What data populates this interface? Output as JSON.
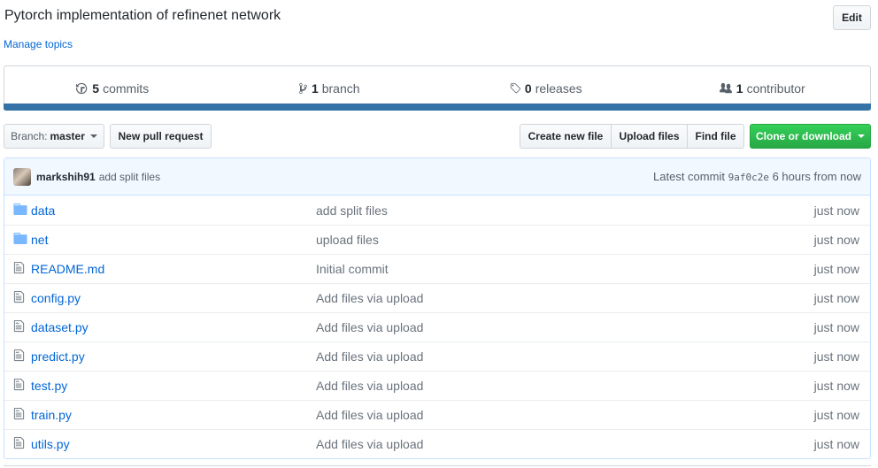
{
  "repo": {
    "description": "Pytorch implementation of refinenet network",
    "manage_topics": "Manage topics",
    "edit_label": "Edit"
  },
  "summary": {
    "commits": {
      "count": "5",
      "label": "commits",
      "icon": "history-icon"
    },
    "branches": {
      "count": "1",
      "label": "branch",
      "icon": "git-branch-icon"
    },
    "releases": {
      "count": "0",
      "label": "releases",
      "icon": "tag-icon"
    },
    "contributors": {
      "count": "1",
      "label": "contributor",
      "icon": "organization-icon"
    },
    "language_color": "#3572a5"
  },
  "toolbar": {
    "branch_prefix": "Branch:",
    "branch_name": "master",
    "new_pr": "New pull request",
    "create_file": "Create new file",
    "upload_files": "Upload files",
    "find_file": "Find file",
    "clone": "Clone or download",
    "clone_color": "#28a745"
  },
  "commit": {
    "author": "markshih91",
    "message": "add split files",
    "latest_label": "Latest commit",
    "sha": "9af0c2e",
    "time": "6 hours from now"
  },
  "files": [
    {
      "name": "data",
      "type": "dir",
      "message": "add split files",
      "age": "just now"
    },
    {
      "name": "net",
      "type": "dir",
      "message": "upload files",
      "age": "just now"
    },
    {
      "name": "README.md",
      "type": "file",
      "message": "Initial commit",
      "age": "just now"
    },
    {
      "name": "config.py",
      "type": "file",
      "message": "Add files via upload",
      "age": "just now"
    },
    {
      "name": "dataset.py",
      "type": "file",
      "message": "Add files via upload",
      "age": "just now"
    },
    {
      "name": "predict.py",
      "type": "file",
      "message": "Add files via upload",
      "age": "just now"
    },
    {
      "name": "test.py",
      "type": "file",
      "message": "Add files via upload",
      "age": "just now"
    },
    {
      "name": "train.py",
      "type": "file",
      "message": "Add files via upload",
      "age": "just now"
    },
    {
      "name": "utils.py",
      "type": "file",
      "message": "Add files via upload",
      "age": "just now"
    }
  ]
}
